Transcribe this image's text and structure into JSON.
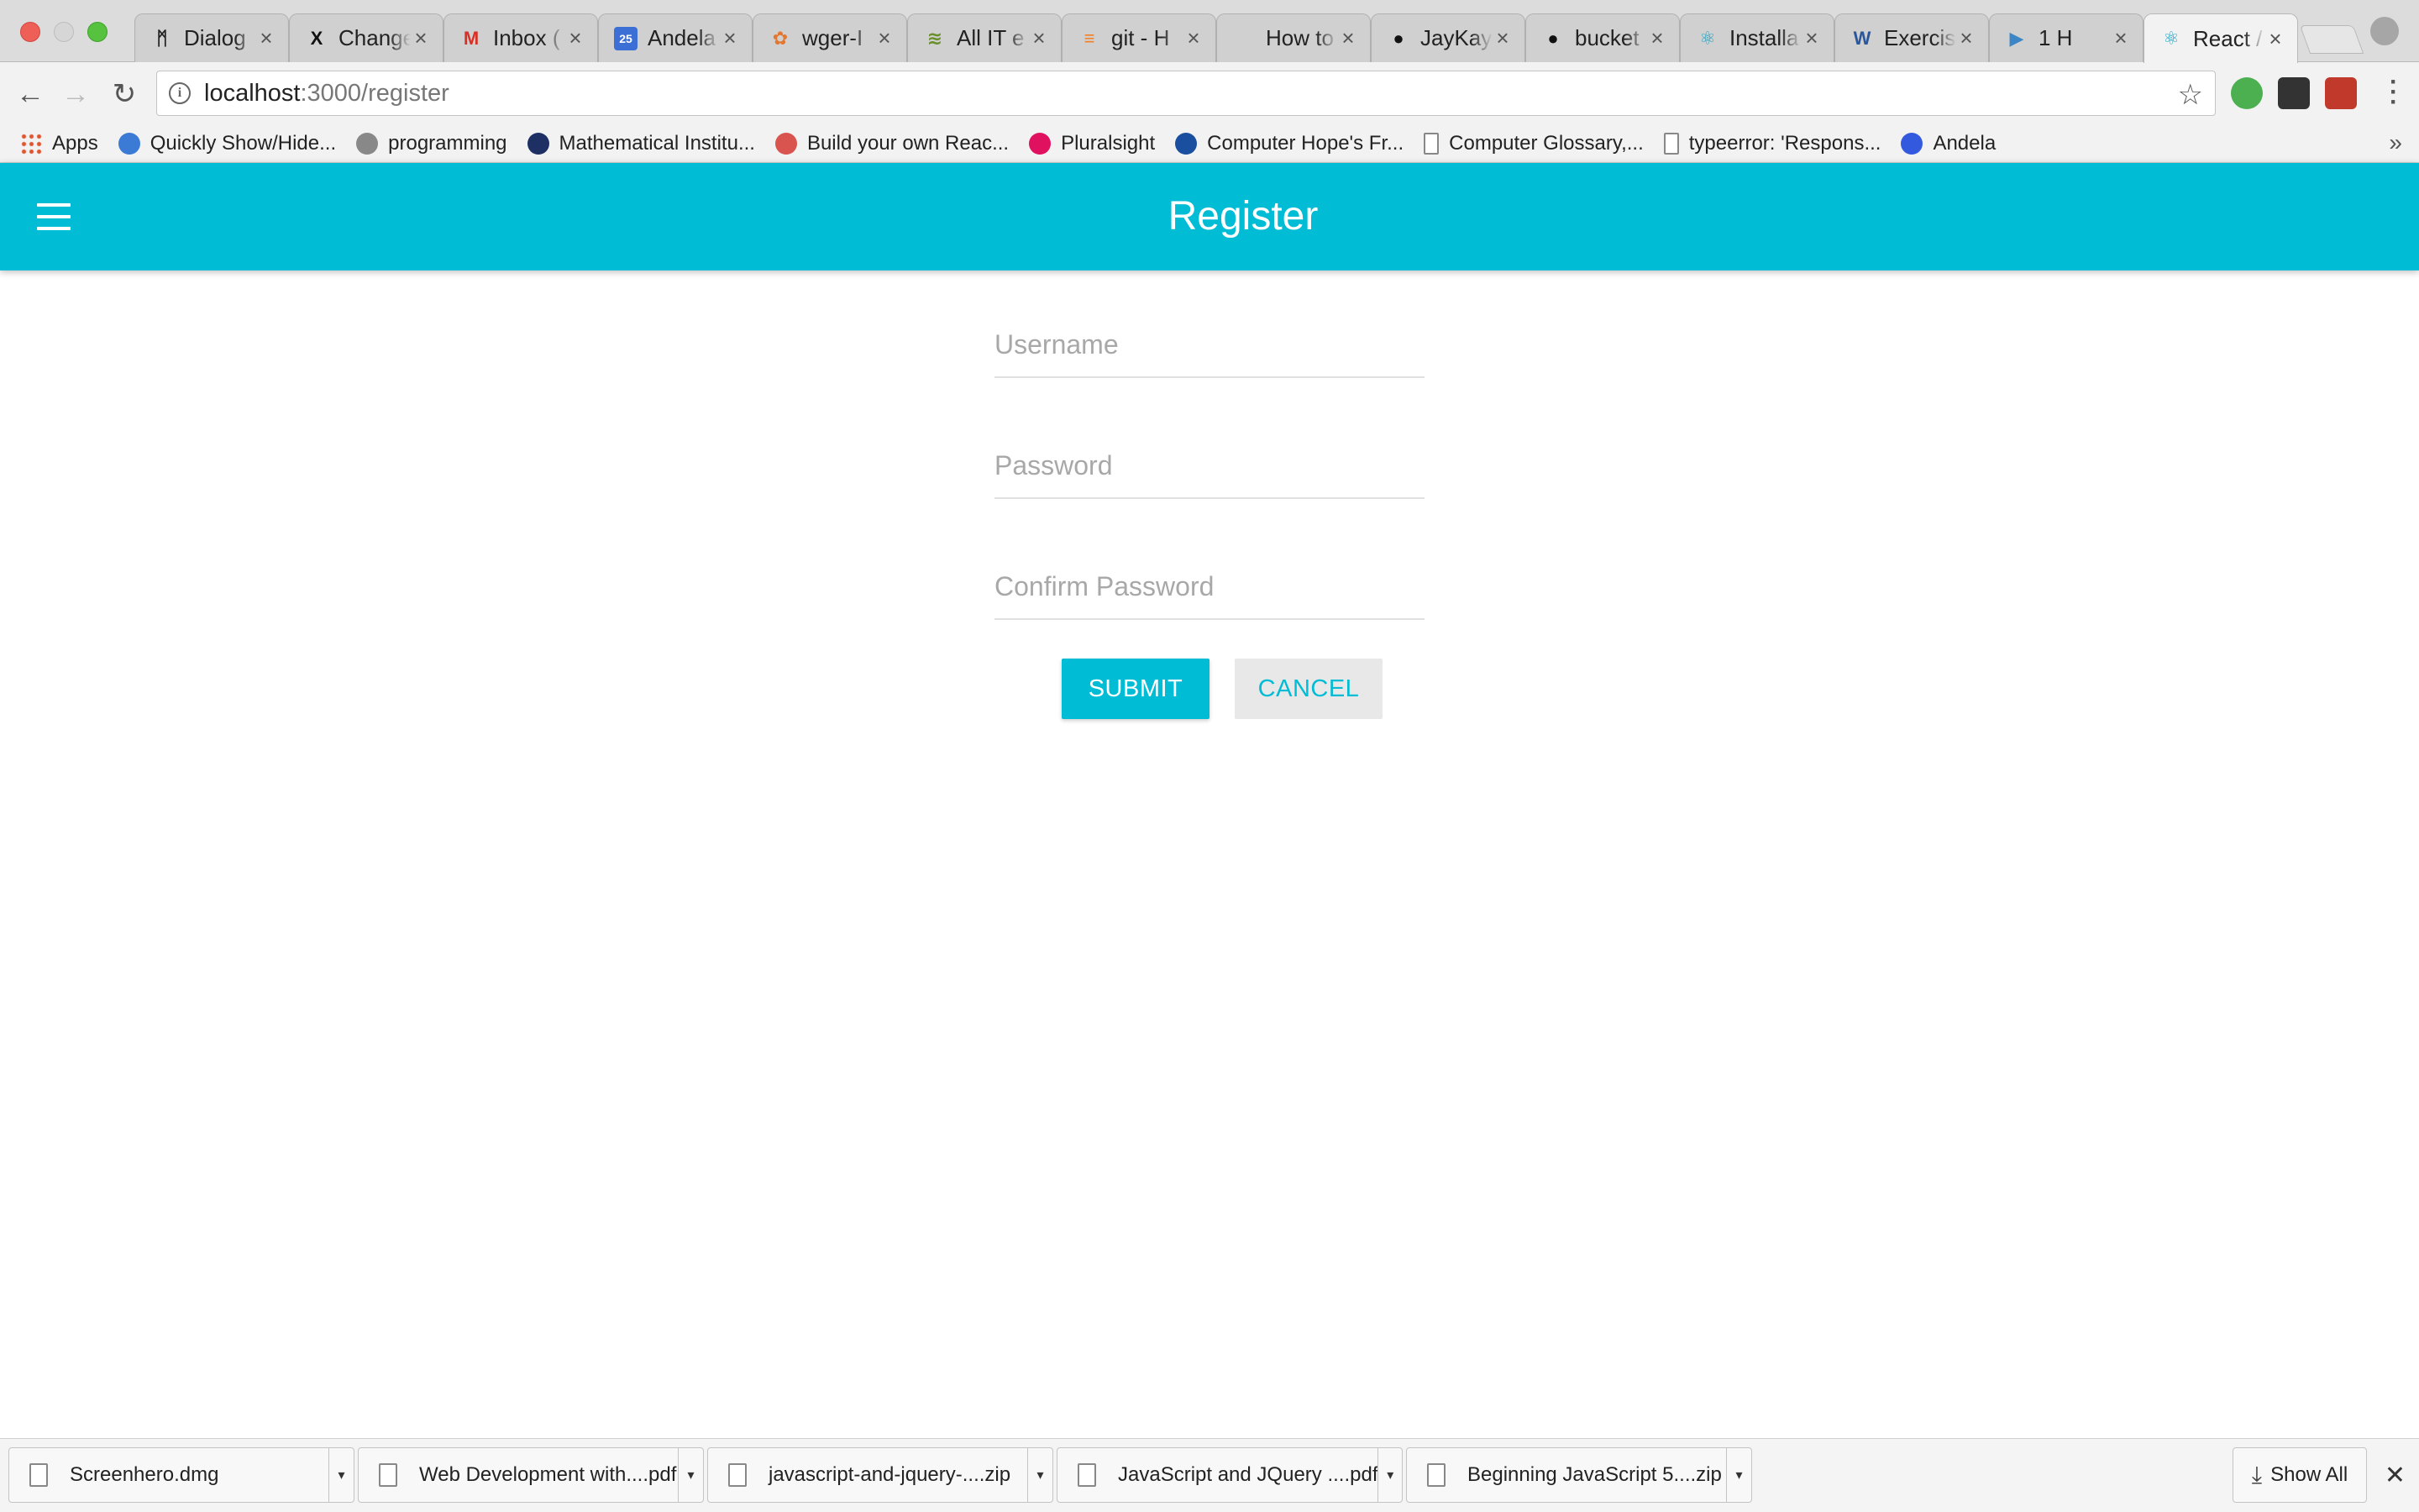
{
  "browser": {
    "tabs": [
      {
        "title": "Dialog",
        "icon": "dialog-icon",
        "fav": "ᛗ",
        "color": "#222222"
      },
      {
        "title": "Change",
        "icon": "x-logo-icon",
        "fav": "X",
        "color": "#111111"
      },
      {
        "title": "Inbox (",
        "icon": "gmail-icon",
        "fav": "M",
        "color": "#d93025"
      },
      {
        "title": "Andela",
        "icon": "calendar-icon",
        "fav": "25",
        "color": "#3b6fd6"
      },
      {
        "title": "wger-I",
        "icon": "wger-icon",
        "fav": "✿",
        "color": "#e4772f"
      },
      {
        "title": "All IT e",
        "icon": "stack-icon",
        "fav": "≋",
        "color": "#6a8e2b"
      },
      {
        "title": "git - H",
        "icon": "stackoverflow-icon",
        "fav": "≡",
        "color": "#f48024"
      },
      {
        "title": "How to",
        "icon": "apple-icon",
        "fav": "",
        "color": "#666666"
      },
      {
        "title": "JayKay",
        "icon": "github-icon",
        "fav": "●",
        "color": "#111111"
      },
      {
        "title": "bucket",
        "icon": "github-icon",
        "fav": "●",
        "color": "#111111"
      },
      {
        "title": "Installa",
        "icon": "react-icon",
        "fav": "⚛",
        "color": "#1ea4c4"
      },
      {
        "title": "Exercis",
        "icon": "word-icon",
        "fav": "W",
        "color": "#2b579a"
      },
      {
        "title": "1 H",
        "icon": "play-icon",
        "fav": "▶",
        "color": "#3d86c6"
      },
      {
        "title": "React /",
        "icon": "react-icon",
        "fav": "⚛",
        "color": "#1ea4c4"
      }
    ],
    "url_host": "localhost",
    "url_path": ":3000/register",
    "bookmarks": [
      {
        "label": "Apps",
        "icon": "apps-grid-icon",
        "color": "#e0552f"
      },
      {
        "label": "Quickly Show/Hide...",
        "icon": "bookmark-icon",
        "color": "#3b7bd6"
      },
      {
        "label": "programming",
        "icon": "reddit-icon",
        "color": "#888888"
      },
      {
        "label": "Mathematical Institu...",
        "icon": "institute-icon",
        "color": "#1e2f63"
      },
      {
        "label": "Build your own Reac...",
        "icon": "react-bookmark-icon",
        "color": "#d9534f"
      },
      {
        "label": "Pluralsight",
        "icon": "pluralsight-icon",
        "color": "#e0115f"
      },
      {
        "label": "Computer Hope's Fr...",
        "icon": "computerhope-icon",
        "color": "#1a4fa0"
      },
      {
        "label": "Computer Glossary,...",
        "icon": "page-icon",
        "color": "#ffffff"
      },
      {
        "label": "typeerror: 'Respons...",
        "icon": "page-icon",
        "color": "#ffffff"
      },
      {
        "label": "Andela",
        "icon": "andela-icon",
        "color": "#3359df"
      }
    ]
  },
  "app": {
    "title": "Register",
    "form": {
      "username_placeholder": "Username",
      "password_placeholder": "Password",
      "confirm_placeholder": "Confirm Password",
      "submit_label": "SUBMIT",
      "cancel_label": "CANCEL"
    },
    "accent_color": "#00bcd4"
  },
  "downloads": {
    "items": [
      {
        "name": "Screenhero.dmg"
      },
      {
        "name": "Web Development with....pdf"
      },
      {
        "name": "javascript-and-jquery-....zip"
      },
      {
        "name": "JavaScript and JQuery ....pdf"
      },
      {
        "name": "Beginning JavaScript 5....zip"
      }
    ],
    "show_all_label": "Show All"
  }
}
